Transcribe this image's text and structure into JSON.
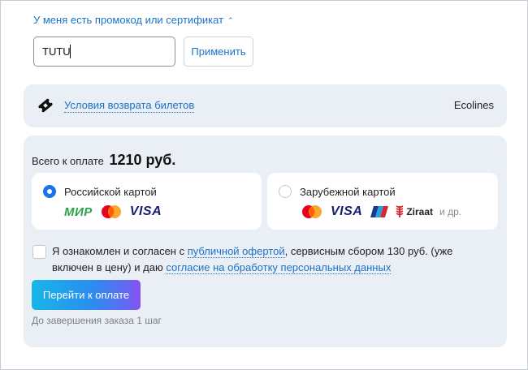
{
  "promo": {
    "toggle_label": "У меня есть промокод или сертификат",
    "input_value": "TUTU",
    "apply_label": "Применить"
  },
  "refund": {
    "link_label": "Условия возврата билетов",
    "carrier": "Ecolines"
  },
  "payment": {
    "total_label": "Всего к оплате",
    "total_amount": "1210 руб.",
    "options": [
      {
        "label": "Российской картой",
        "selected": true,
        "logos": [
          "МИР",
          "mastercard",
          "VISA"
        ]
      },
      {
        "label": "Зарубежной картой",
        "selected": false,
        "logos": [
          "mastercard",
          "VISA",
          "bank-card",
          "Ziraat"
        ],
        "more": "и др."
      }
    ],
    "agreement": {
      "part1": "Я ознакомлен и согласен с",
      "offer_link": "публичной офертой",
      "part2": ", сервисным сбором 130 руб. (уже включен в цену) и даю",
      "consent_link": "согласие на обработку персональных данных",
      "checked": false
    },
    "proceed_label": "Перейти к оплате",
    "steps_left": "До завершения заказа 1 шаг"
  },
  "colors": {
    "link": "#1a73c8",
    "radio_selected": "#1a73e8",
    "panel_bg": "#eaeef5",
    "mir_green": "#2aa34a",
    "visa_blue": "#1a1f71",
    "mc_red": "#eb001b",
    "mc_orange": "#f79e1b"
  }
}
